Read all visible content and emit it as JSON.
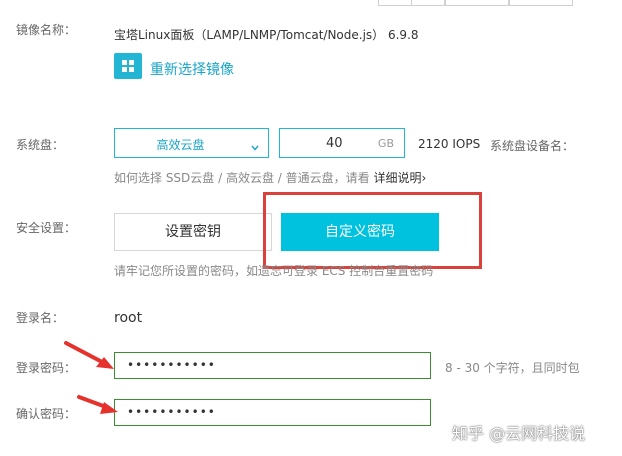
{
  "image": {
    "label": "镜像名称：",
    "value": "宝塔Linux面板（LAMP/LNMP/Tomcat/Node.js） 6.9.8",
    "change_link": "重新选择镜像",
    "change_icon": "grid-icon"
  },
  "system_disk": {
    "label": "系统盘：",
    "type_value": "高效云盘",
    "size_value": "40",
    "size_unit": "GB",
    "iops": "2120 IOPS",
    "device_label": "系统盘设备名：",
    "help_prefix": "如何选择 SSD云盘 / 高效云盘 / 普通云盘，请看",
    "help_link": "详细说明",
    "help_arrow": "›"
  },
  "security": {
    "label": "安全设置：",
    "set_key_label": "设置密钥",
    "custom_password_label": "自定义密码",
    "hint": "请牢记您所设置的密码，如遗忘可登录 ECS 控制台重置密码"
  },
  "login": {
    "name_label": "登录名：",
    "name_value": "root",
    "password_label": "登录密码：",
    "password_value": "•••••••••••",
    "password_hint": "8 - 30 个字符，且同时包",
    "confirm_label": "确认密码：",
    "confirm_value": "•••••••••••"
  },
  "watermark": "知乎 @云网科技说",
  "colors": {
    "accent": "#00c1de",
    "accent_text": "#1aa5c8",
    "highlight": "#d9413a",
    "field_border": "#3c8d2f",
    "arrow": "#e5322d"
  }
}
